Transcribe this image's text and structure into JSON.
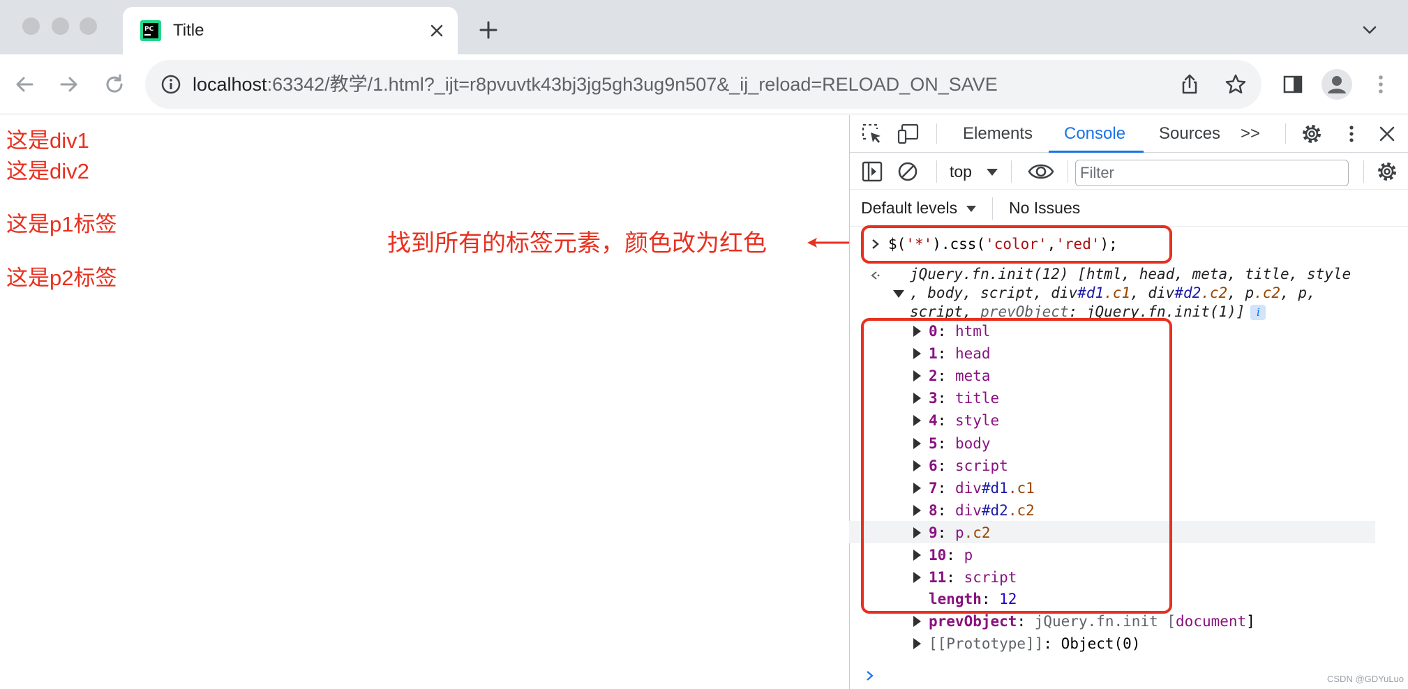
{
  "browser": {
    "tab_title": "Title",
    "url_host": "localhost",
    "url_rest": ":63342/教学/1.html?_ijt=r8pvuvtk43bj3jg5gh3ug9n507&_ij_reload=RELOAD_ON_SAVE"
  },
  "page": {
    "lines": [
      "这是div1",
      "这是div2",
      "这是p1标签",
      "这是p2标签"
    ],
    "text_color": "#e8301f"
  },
  "annotation": {
    "text": "找到所有的标签元素，颜色改为红色",
    "color": "#e8301f"
  },
  "devtools": {
    "tabs": [
      "Elements",
      "Console",
      "Sources"
    ],
    "active_tab": "Console",
    "overflow_label": ">>",
    "context": "top",
    "filter_placeholder": "Filter",
    "levels_label": "Default levels",
    "issues_label": "No Issues"
  },
  "console": {
    "prompt_symbol": ">",
    "input_prefix": "$(",
    "input_arg1": "'*'",
    "input_mid": ").css(",
    "input_arg2": "'color'",
    "input_comma": ",",
    "input_arg3": "'red'",
    "input_suffix": ");",
    "result_line1": "jQuery.fn.init(12) [html, head, meta, title, style",
    "result_line2_a": ", body, script, div",
    "result_line2_b": "#d1",
    "result_line2_c": ".c1",
    "result_line2_d": ", div",
    "result_line2_e": "#d2",
    "result_line2_f": ".c2",
    "result_line2_g": ", p",
    "result_line2_h": ".c2",
    "result_line2_i": ", p,",
    "result_line3_a": "script, ",
    "result_line3_b": "prevObject",
    "result_line3_c": ": jQuery.fn.init(1)]",
    "info_badge": "i",
    "items": [
      {
        "key": "0",
        "tag": "html",
        "id": "",
        "cls": ""
      },
      {
        "key": "1",
        "tag": "head",
        "id": "",
        "cls": ""
      },
      {
        "key": "2",
        "tag": "meta",
        "id": "",
        "cls": ""
      },
      {
        "key": "3",
        "tag": "title",
        "id": "",
        "cls": ""
      },
      {
        "key": "4",
        "tag": "style",
        "id": "",
        "cls": ""
      },
      {
        "key": "5",
        "tag": "body",
        "id": "",
        "cls": ""
      },
      {
        "key": "6",
        "tag": "script",
        "id": "",
        "cls": ""
      },
      {
        "key": "7",
        "tag": "div",
        "id": "#d1",
        "cls": ".c1"
      },
      {
        "key": "8",
        "tag": "div",
        "id": "#d2",
        "cls": ".c2"
      },
      {
        "key": "9",
        "tag": "p",
        "id": "",
        "cls": ".c2"
      },
      {
        "key": "10",
        "tag": "p",
        "id": "",
        "cls": ""
      },
      {
        "key": "11",
        "tag": "script",
        "id": "",
        "cls": ""
      }
    ],
    "length_key": "length",
    "length_val": "12",
    "prev_key": "prevObject",
    "prev_val_a": "jQuery.fn.init [",
    "prev_val_b": "document",
    "prev_val_c": "]",
    "proto_key": "[[Prototype]]",
    "proto_val": "Object(0)",
    "bottom_prompt": ">"
  },
  "watermark": "CSDN @GDYuLuo",
  "colors": {
    "accent": "#1a73e8",
    "highlight_box": "#e8301f"
  }
}
